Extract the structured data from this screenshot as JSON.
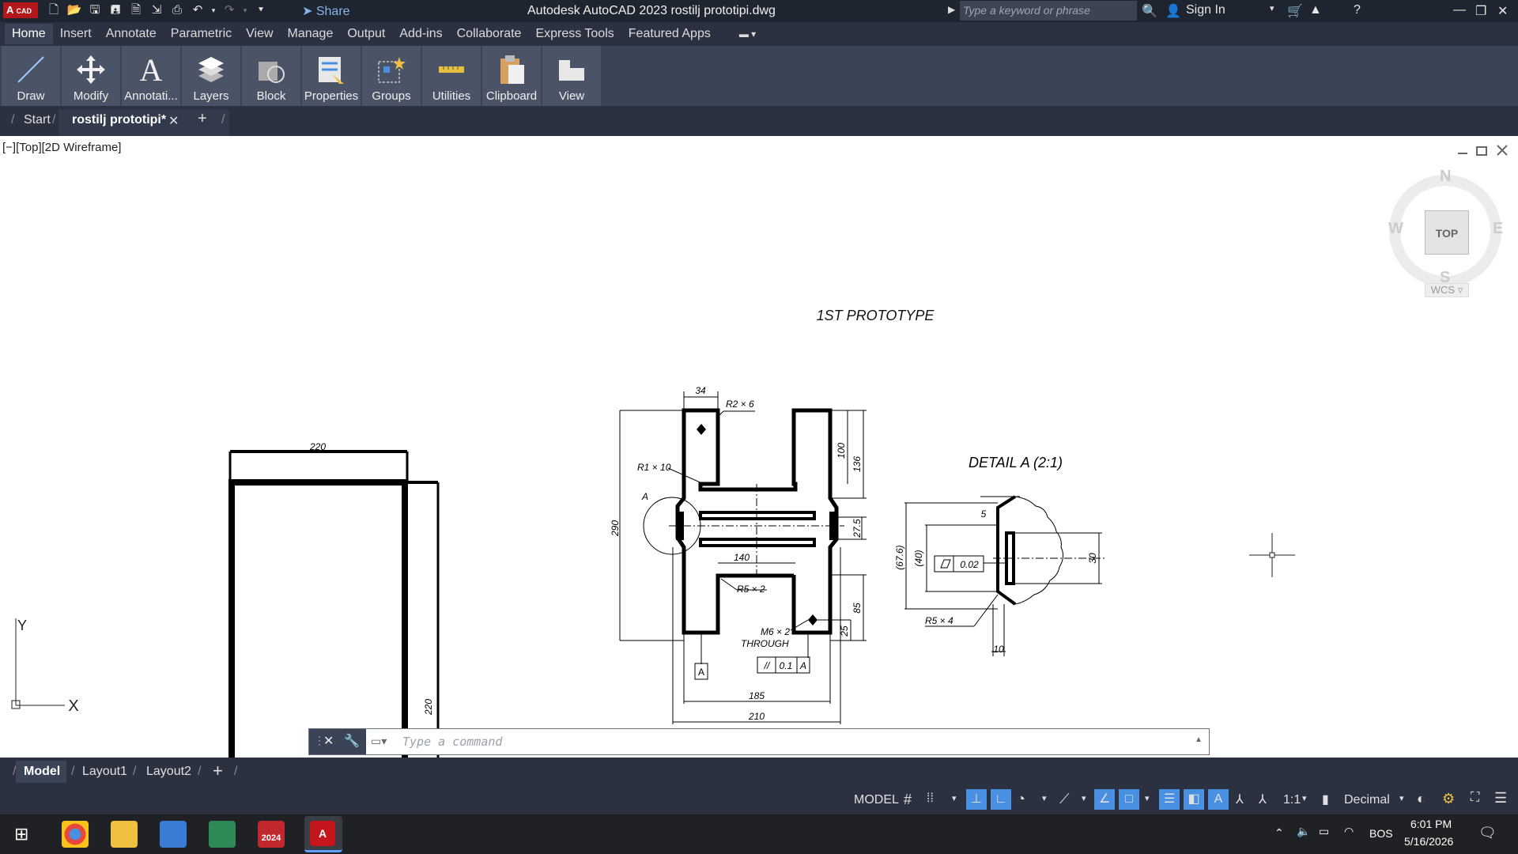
{
  "titlebar": {
    "logo_main": "A",
    "logo_sub": "CAD",
    "share_label": "Share",
    "title": "Autodesk AutoCAD 2023    rostilj prototipi.dwg",
    "search_placeholder": "Type a keyword or phrase",
    "sign_in": "Sign In"
  },
  "menu": {
    "items": [
      "Home",
      "Insert",
      "Annotate",
      "Parametric",
      "View",
      "Manage",
      "Output",
      "Add-ins",
      "Collaborate",
      "Express Tools",
      "Featured Apps"
    ]
  },
  "ribbon": {
    "panels": [
      "Draw",
      "Modify",
      "Annotati...",
      "Layers",
      "Block",
      "Properties",
      "Groups",
      "Utilities",
      "Clipboard",
      "View"
    ]
  },
  "doc_tabs": {
    "start": "Start",
    "active": "rostilj prototipi*"
  },
  "viewport": {
    "label": "[−][Top][2D Wireframe]",
    "viewcube": {
      "top": "TOP",
      "n": "N",
      "s": "S",
      "e": "E",
      "w": "W",
      "wcs": "WCS"
    }
  },
  "drawing": {
    "title": "1ST PROTOTYPE",
    "detail_title": "DETAIL A  (2:1)",
    "square_dims": {
      "width": "220",
      "height": "220"
    },
    "part_dims": {
      "d34": "34",
      "r2x6": "R2 × 6",
      "r1x10": "R1 × 10",
      "a_label": "A",
      "h290": "290",
      "h100": "100",
      "h136": "136",
      "h27_5": "27.5",
      "w140": "140",
      "r5x2": "R5 × 2",
      "m6x2": "M6 × 2",
      "through": "THROUGH",
      "tol_sym": "//",
      "tol_val": "0.1",
      "tol_ref": "A",
      "h85": "85",
      "h25": "25",
      "w185": "185",
      "w210": "210",
      "datum_a": "A"
    },
    "detail_dims": {
      "d5": "5",
      "d67_6": "(67.6)",
      "d40": "(40)",
      "flat_val": "0.02",
      "d30": "30",
      "r5x4": "R5 × 4",
      "d10": "10"
    },
    "ucs": {
      "x": "X",
      "y": "Y"
    }
  },
  "command": {
    "placeholder": "Type a command"
  },
  "layout_tabs": [
    "Model",
    "Layout1",
    "Layout2"
  ],
  "status": {
    "model": "MODEL",
    "scale": "1:1",
    "units": "Decimal"
  },
  "taskbar": {
    "sw_label": "2024",
    "lang": "BOS",
    "time": "6:01 PM",
    "date": "5/16/2026"
  },
  "colors": {
    "accent": "#b3171c",
    "chrome_dark": "#2b3141",
    "ribbon": "#3b4457",
    "status_active": "#4a90e2"
  }
}
